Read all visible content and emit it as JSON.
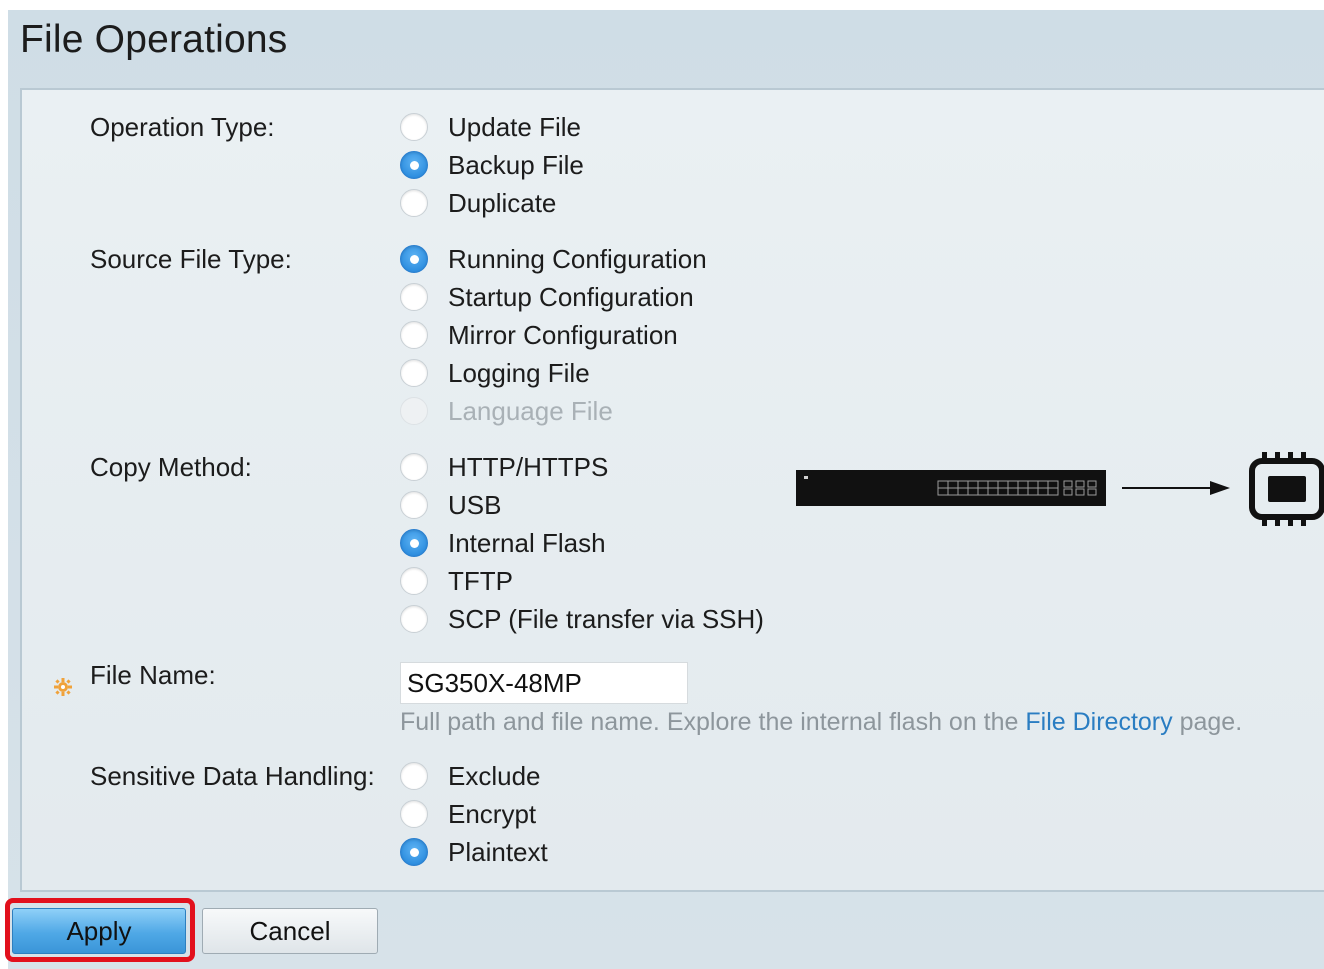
{
  "page": {
    "title": "File Operations"
  },
  "form": {
    "operation_type": {
      "label": "Operation Type:",
      "options": [
        {
          "label": "Update File",
          "checked": false,
          "disabled": false
        },
        {
          "label": "Backup File",
          "checked": true,
          "disabled": false
        },
        {
          "label": "Duplicate",
          "checked": false,
          "disabled": false
        }
      ]
    },
    "source_file_type": {
      "label": "Source File Type:",
      "options": [
        {
          "label": "Running Configuration",
          "checked": true,
          "disabled": false
        },
        {
          "label": "Startup Configuration",
          "checked": false,
          "disabled": false
        },
        {
          "label": "Mirror Configuration",
          "checked": false,
          "disabled": false
        },
        {
          "label": "Logging File",
          "checked": false,
          "disabled": false
        },
        {
          "label": "Language File",
          "checked": false,
          "disabled": true
        }
      ]
    },
    "copy_method": {
      "label": "Copy Method:",
      "options": [
        {
          "label": "HTTP/HTTPS",
          "checked": false,
          "disabled": false
        },
        {
          "label": "USB",
          "checked": false,
          "disabled": false
        },
        {
          "label": "Internal Flash",
          "checked": true,
          "disabled": false
        },
        {
          "label": "TFTP",
          "checked": false,
          "disabled": false
        },
        {
          "label": "SCP (File transfer via SSH)",
          "checked": false,
          "disabled": false
        }
      ]
    },
    "file_name": {
      "label": "File Name:",
      "value": "SG350X-48MP",
      "hint_prefix": "Full path and file name. Explore the internal flash on the ",
      "hint_link": "File Directory",
      "hint_suffix": " page."
    },
    "sensitive_data": {
      "label": "Sensitive Data Handling:",
      "options": [
        {
          "label": "Exclude",
          "checked": false,
          "disabled": false
        },
        {
          "label": "Encrypt",
          "checked": false,
          "disabled": false
        },
        {
          "label": "Plaintext",
          "checked": true,
          "disabled": false
        }
      ]
    }
  },
  "graphics": {
    "diagram_icons": [
      "switch-icon",
      "arrow-right-icon",
      "memory-chip-icon"
    ],
    "required_icon": "gear-icon"
  },
  "buttons": {
    "apply": "Apply",
    "cancel": "Cancel"
  },
  "colors": {
    "accent": "#2f8fe0",
    "link": "#2a7dc2",
    "highlight": "#e2101c",
    "required": "#f0a23a"
  }
}
